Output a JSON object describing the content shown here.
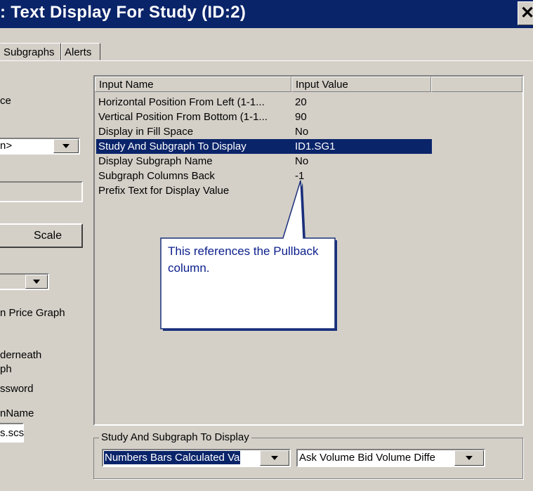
{
  "window": {
    "title": ": Text Display For Study (ID:2)",
    "close_glyph": "✕"
  },
  "tabs": [
    "Subgraphs",
    "Alerts"
  ],
  "left_panel": {
    "frag_ce": "ce",
    "frag_combo1": "n>",
    "scale_button": "Scale",
    "frag_price_graph": "n Price Graph",
    "frag_underneath": "derneath",
    "frag_ph": "ph",
    "frag_password": "ssword",
    "frag_name": "nName",
    "frag_file": "s.scs"
  },
  "inputs_table": {
    "columns": [
      "Input Name",
      "Input Value"
    ],
    "rows": [
      {
        "name": "Horizontal Position From Left (1-1...",
        "value": "20",
        "selected": false
      },
      {
        "name": "Vertical Position From Bottom (1-1...",
        "value": "90",
        "selected": false
      },
      {
        "name": "Display in Fill Space",
        "value": "No",
        "selected": false
      },
      {
        "name": "Study And Subgraph To Display",
        "value": "ID1.SG1",
        "selected": true
      },
      {
        "name": "Display Subgraph Name",
        "value": "No",
        "selected": false
      },
      {
        "name": "Subgraph Columns Back",
        "value": "-1",
        "selected": false
      },
      {
        "name": "Prefix Text for Display Value",
        "value": "",
        "selected": false
      }
    ]
  },
  "callout": {
    "text": "This references the Pullback column."
  },
  "bottom_group": {
    "label": "Study And Subgraph To Display",
    "study_combo_value": "Numbers Bars Calculated Va",
    "subgraph_combo_value": "Ask Volume Bid Volume Diffe"
  },
  "colors": {
    "titlebar": "#0a246a",
    "face": "#d4d0c8",
    "selection": "#0a246a",
    "callout_text": "#0a1e8c"
  }
}
